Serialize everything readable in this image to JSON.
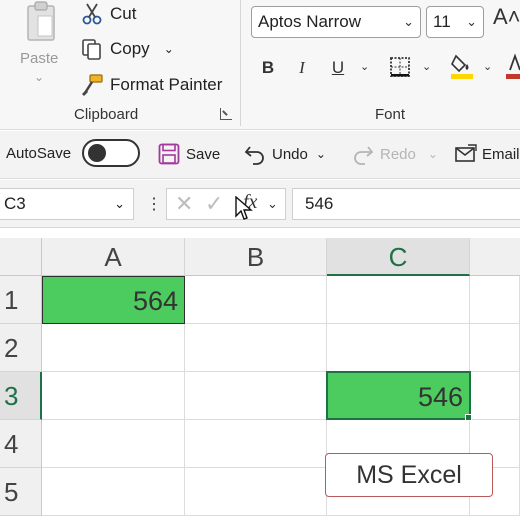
{
  "clipboard": {
    "paste_label": "Paste",
    "cut_label": "Cut",
    "copy_label": "Copy",
    "format_painter_label": "Format Painter",
    "group_label": "Clipboard"
  },
  "font": {
    "font_name": "Aptos Narrow",
    "font_size": "11",
    "grow_font": "A˄",
    "bold": "B",
    "italic": "I",
    "underline": "U",
    "group_label": "Font",
    "highlight_color": "#ffd700",
    "font_color": "#c0392b"
  },
  "qat": {
    "autosave_label": "AutoSave",
    "save_label": "Save",
    "undo_label": "Undo",
    "redo_label": "Redo",
    "email_label": "Email"
  },
  "formula_bar": {
    "name_box": "C3",
    "fx": "fx",
    "value": "546"
  },
  "grid": {
    "columns": [
      "A",
      "B",
      "C"
    ],
    "rows": [
      "1",
      "2",
      "3",
      "4",
      "5"
    ],
    "cells": {
      "A1": "564",
      "C3": "546"
    },
    "fill_color": "#4ccc5e",
    "selection_color": "#1e7145"
  },
  "badge": {
    "text": "MS Excel"
  }
}
